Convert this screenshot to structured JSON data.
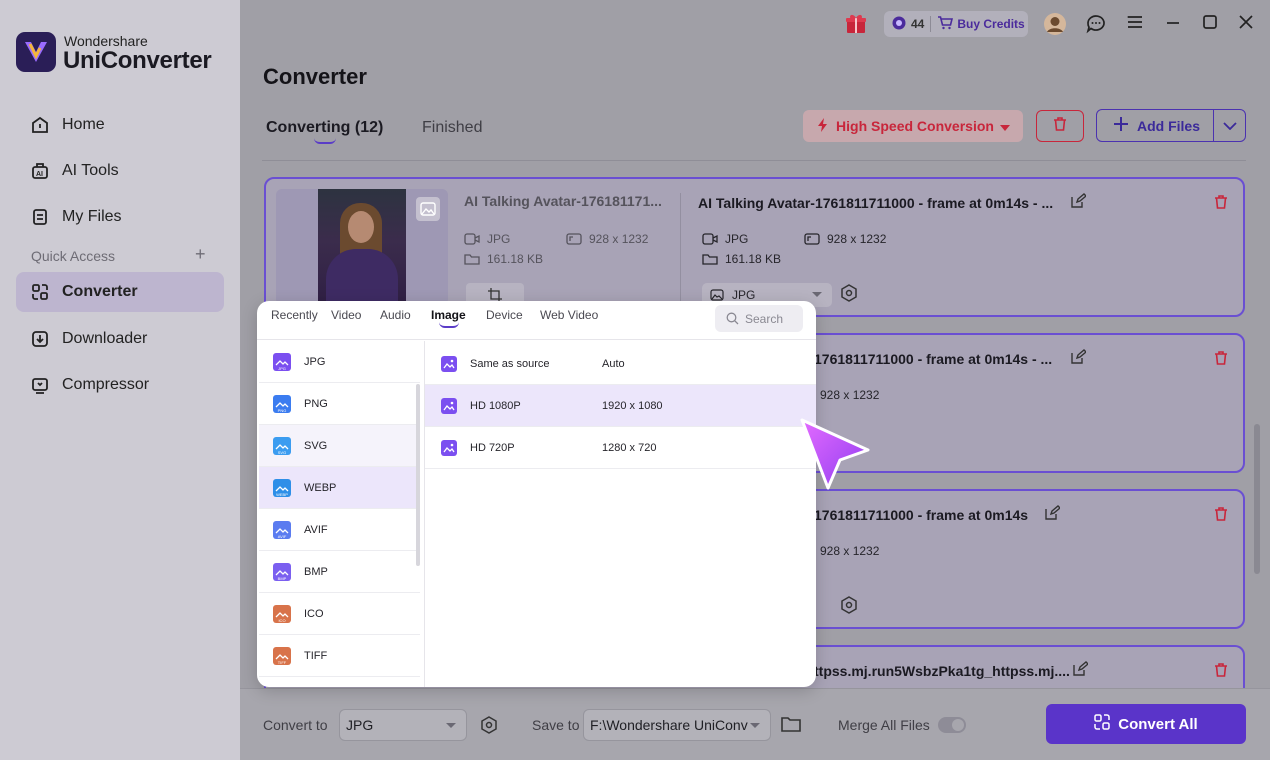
{
  "app": {
    "brand_top": "Wondershare",
    "brand_name": "UniConverter"
  },
  "sidebar": {
    "items": [
      {
        "label": "Home",
        "icon": "home-icon"
      },
      {
        "label": "AI Tools",
        "icon": "ai-tools-icon"
      },
      {
        "label": "My Files",
        "icon": "my-files-icon"
      }
    ],
    "quick_access_label": "Quick Access",
    "quick_items": [
      {
        "label": "Converter",
        "icon": "converter-icon",
        "active": true
      },
      {
        "label": "Downloader",
        "icon": "downloader-icon"
      },
      {
        "label": "Compressor",
        "icon": "compressor-icon"
      }
    ]
  },
  "topbar": {
    "credits": "44",
    "buy_credits": "Buy Credits"
  },
  "page": {
    "title": "Converter",
    "tab_converting": "Converting (12)",
    "tab_finished": "Finished",
    "high_speed": "High Speed Conversion",
    "add_files": "Add Files"
  },
  "files": [
    {
      "src_name": "AI Talking Avatar-176181171...",
      "src_format": "JPG",
      "src_resolution": "928 x 1232",
      "src_size": "161.18 KB",
      "dst_name": "AI Talking Avatar-1761811711000 - frame at 0m14s - ...",
      "dst_format": "JPG",
      "dst_resolution": "928 x 1232",
      "dst_size": "161.18 KB",
      "output_format": "JPG"
    },
    {
      "dst_name": "1761811711000 - frame at 0m14s - ...",
      "dst_resolution": "928 x 1232"
    },
    {
      "dst_name": "1761811711000 - frame at 0m14s",
      "dst_resolution": "928 x 1232"
    },
    {
      "dst_name": "ttpss.mj.run5WsbzPka1tg_httpss.mj...."
    }
  ],
  "bottom": {
    "convert_to_label": "Convert to",
    "convert_to_value": "JPG",
    "save_to_label": "Save to",
    "save_to_value": "F:\\Wondershare UniConv",
    "merge_label": "Merge All Files",
    "merge_enabled": false,
    "convert_all": "Convert All"
  },
  "popup": {
    "tabs": [
      "Recently",
      "Video",
      "Audio",
      "Image",
      "Device",
      "Web Video"
    ],
    "active_tab": "Image",
    "search_placeholder": "Search",
    "formats": [
      {
        "label": "JPG",
        "badge": "JPG",
        "color": "#7b4ff0"
      },
      {
        "label": "PNG",
        "badge": "PNG",
        "color": "#3b7cf0"
      },
      {
        "label": "SVG",
        "badge": "SVG",
        "color": "#3b9cf0"
      },
      {
        "label": "WEBP",
        "badge": "WEBP",
        "color": "#2e8fe8"
      },
      {
        "label": "AVIF",
        "badge": "AVIF",
        "color": "#5b7cf0"
      },
      {
        "label": "BMP",
        "badge": "BMP",
        "color": "#7b5ff0"
      },
      {
        "label": "ICO",
        "badge": "ICO",
        "color": "#d8734a"
      },
      {
        "label": "TIFF",
        "badge": "TIFF",
        "color": "#d8734a"
      }
    ],
    "selected_format": "WEBP",
    "presets": [
      {
        "name": "Same as source",
        "value": "Auto"
      },
      {
        "name": "HD 1080P",
        "value": "1920 x 1080"
      },
      {
        "name": "HD 720P",
        "value": "1280 x 720"
      }
    ],
    "selected_preset": "HD 1080P"
  }
}
